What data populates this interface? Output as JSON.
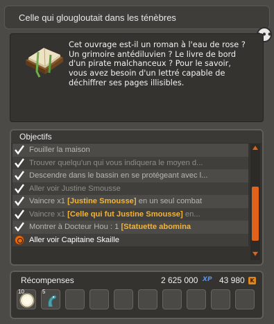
{
  "title": "Celle qui glougloutait dans les ténèbres",
  "more_label": "•••",
  "description": "Cet ouvrage est-il un roman à l'eau de rose ?\nUn grimoire antédiluvien ? Le livre de bord\nd'un pirate malchanceux ? Pour le savoir,\nvous avez besoin d'un lettré capable de\ndéchiffrer ses pages illisibles.",
  "objectives": {
    "header": "Objectifs",
    "items": [
      {
        "prefix": "",
        "text": "Fouiller la maison",
        "suffix": ""
      },
      {
        "prefix": "",
        "text": "Trouver quelqu'un qui vous indiquera le moyen d...",
        "suffix": ""
      },
      {
        "prefix": "",
        "text": "Descendre dans le bassin en se protégeant avec l...",
        "suffix": ""
      },
      {
        "prefix": "",
        "text": "Aller voir Justine Smousse",
        "suffix": ""
      },
      {
        "prefix": "Vaincre x1 ",
        "text": "[Justine Smousse]",
        "suffix": " en un seul combat"
      },
      {
        "prefix": "Vaincre x1 ",
        "text": "[Celle qui fut Justine Smousse]",
        "suffix": " en..."
      },
      {
        "prefix": "Montrer à Docteur Hou : 1 ",
        "text": "[Statuette abomina",
        "suffix": ""
      },
      {
        "prefix": "",
        "text": "Aller voir Capitaine Skaille",
        "suffix": ""
      }
    ]
  },
  "rewards": {
    "label": "Récompenses",
    "xp": "2 625 000",
    "xp_unit": "XP",
    "kamas": "43 980",
    "kamas_unit": "K",
    "items": [
      {
        "qty": "10",
        "icon": "light-orb-icon"
      },
      {
        "qty": "5",
        "icon": "tentacle-icon"
      }
    ],
    "empty_slots": 8
  },
  "colors": {
    "accent": "#e2621a",
    "highlight": "#f3b43a",
    "xp": "#5f8fd6"
  }
}
